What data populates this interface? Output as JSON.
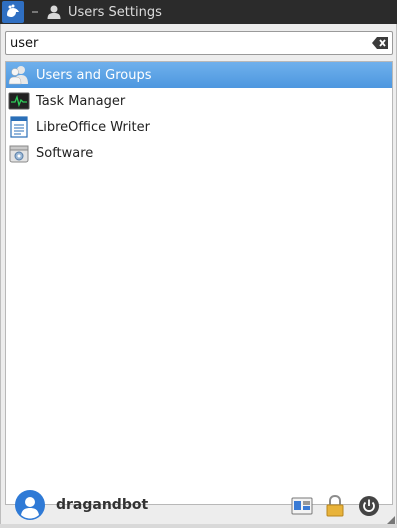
{
  "panel": {
    "app_title": "Users Settings"
  },
  "search": {
    "value": "user",
    "placeholder": ""
  },
  "results": [
    {
      "label": "Users and Groups",
      "icon": "users-icon",
      "selected": true
    },
    {
      "label": "Task Manager",
      "icon": "task-manager-icon",
      "selected": false
    },
    {
      "label": "LibreOffice Writer",
      "icon": "writer-icon",
      "selected": false
    },
    {
      "label": "Software",
      "icon": "software-icon",
      "selected": false
    }
  ],
  "user": {
    "name": "dragandbot"
  },
  "colors": {
    "selection": "#4d97df",
    "accent": "#2f7ad6",
    "panel": "#2b2b2b"
  }
}
